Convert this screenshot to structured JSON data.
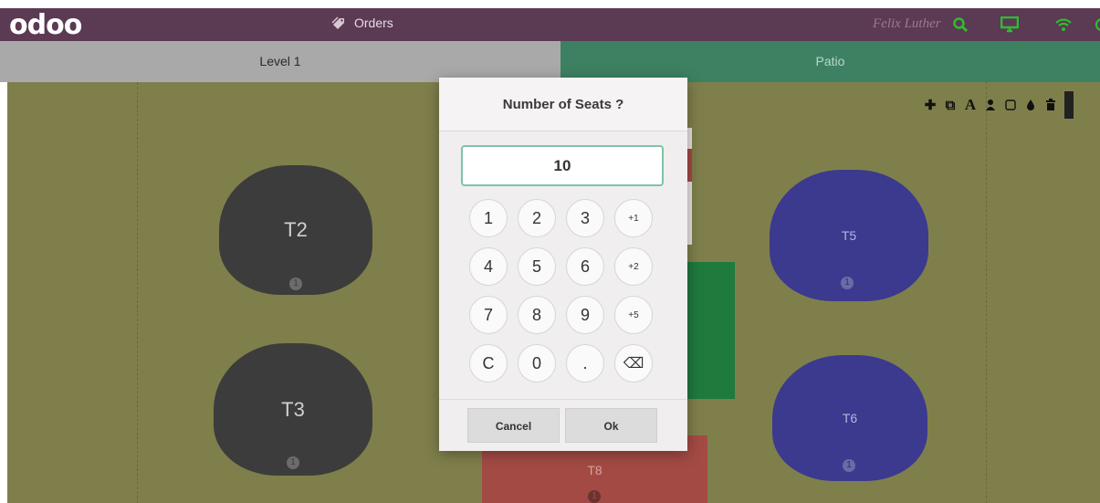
{
  "app": {
    "logo": "odoo",
    "orders_label": "Orders",
    "cashier": "Felix Luther",
    "icons": [
      "search-icon",
      "screen-icon",
      "wifi-icon"
    ],
    "colors": {
      "accent": "#5b3a53",
      "icon_green": "#2ebd2e"
    }
  },
  "floors": {
    "tabs": [
      {
        "label": "Level 1",
        "active": false
      },
      {
        "label": "Patio",
        "active": true
      }
    ]
  },
  "tables": [
    {
      "name": "T2",
      "seats": "1",
      "color": "#3c3c3c"
    },
    {
      "name": "T3",
      "seats": "1",
      "color": "#3c3c3c"
    },
    {
      "name": "T5",
      "seats": "1",
      "color": "#3b3a8f"
    },
    {
      "name": "T6",
      "seats": "1",
      "color": "#3b3a8f"
    },
    {
      "name": "T8",
      "seats": "1",
      "color": "#a44a45"
    }
  ],
  "edit_toolbar": {
    "icons": [
      "plus-icon",
      "duplicate-icon",
      "rename-icon",
      "seats-icon",
      "shape-icon",
      "color-icon",
      "trash-icon"
    ]
  },
  "modal": {
    "title": "Number of Seats ?",
    "input_value": "10",
    "keys": [
      "1",
      "2",
      "3",
      "+1",
      "4",
      "5",
      "6",
      "+2",
      "7",
      "8",
      "9",
      "+5",
      "C",
      "0",
      ".",
      "⌫"
    ],
    "cancel_label": "Cancel",
    "ok_label": "Ok"
  }
}
